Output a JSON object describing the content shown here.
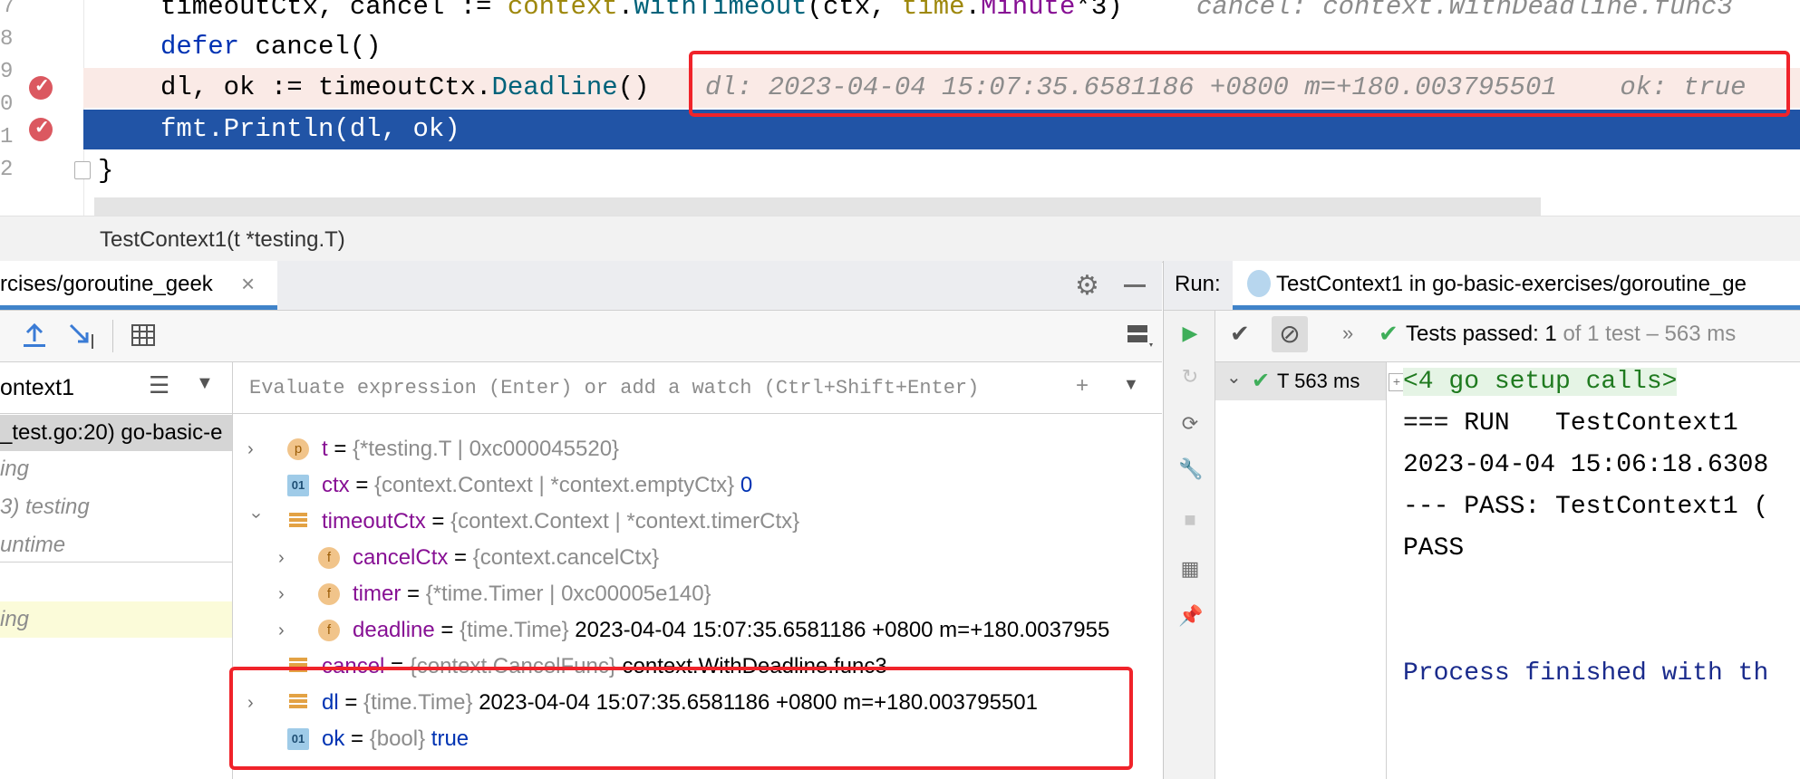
{
  "editor": {
    "line_numbers": [
      "7",
      "8",
      "9",
      "0",
      "1",
      "2"
    ],
    "lines": [
      {
        "code": "timeoutCtx, cancel := context.WithTimeout(ctx, time.Minute*3)",
        "hint": "cancel: context.WithDeadline.func3"
      },
      {
        "code": "defer cancel()"
      },
      {
        "code": "dl, ok := timeoutCtx.Deadline()",
        "hint": "dl: 2023-04-04 15:07:35.6581186 +0800 m=+180.003795501    ok: true"
      },
      {
        "code": "fmt.Println(dl, ok)"
      },
      {
        "code": "}"
      }
    ],
    "colors": {
      "execution_line": "#2154a6",
      "breakpoint_line": "#faeae6",
      "highlight_box": "#f0232a"
    }
  },
  "breadcrumb": {
    "text": "TestContext1(t *testing.T)"
  },
  "debug": {
    "tab_label": "rcises/goroutine_geek",
    "close_icon": "×",
    "evaluate_placeholder": "Evaluate expression (Enter) or add a watch (Ctrl+Shift+Enter)",
    "thread_name": "ontext1",
    "frames": [
      {
        "text": "_test.go:20) go-basic-e",
        "style": "selected"
      },
      {
        "text": "ing",
        "style": "normal"
      },
      {
        "text": "3) testing",
        "style": "normal"
      },
      {
        "text": "untime",
        "style": "normal"
      },
      {
        "text": "ing",
        "style": "library"
      }
    ],
    "variables": [
      {
        "name": "t",
        "type": "{*testing.T | 0xc000045520}",
        "value": "",
        "icon": "p",
        "expandable": true,
        "expanded": false,
        "indent": 0
      },
      {
        "name": "ctx",
        "type": "{context.Context | *context.emptyCtx}",
        "value": "0",
        "icon": "01",
        "expandable": false,
        "indent": 0,
        "value_blue": true
      },
      {
        "name": "timeoutCtx",
        "type": "{context.Context | *context.timerCtx}",
        "value": "",
        "icon": "bars",
        "expandable": true,
        "expanded": true,
        "indent": 0
      },
      {
        "name": "cancelCtx",
        "type": "{context.cancelCtx}",
        "value": "",
        "icon": "f",
        "expandable": true,
        "expanded": false,
        "indent": 1
      },
      {
        "name": "timer",
        "type": "{*time.Timer | 0xc00005e140}",
        "value": "",
        "icon": "f",
        "expandable": true,
        "expanded": false,
        "indent": 1
      },
      {
        "name": "deadline",
        "type": "{time.Time}",
        "value": "2023-04-04 15:07:35.6581186 +0800 m=+180.0037955",
        "icon": "f",
        "expandable": true,
        "expanded": false,
        "indent": 1
      },
      {
        "name": "cancel",
        "type": "{context.CancelFunc}",
        "value": "context.WithDeadline.func3",
        "icon": "bars",
        "expandable": false,
        "indent": 0
      },
      {
        "name": "dl",
        "type": "{time.Time}",
        "value": "2023-04-04 15:07:35.6581186 +0800 m=+180.003795501",
        "icon": "bars",
        "expandable": true,
        "expanded": false,
        "indent": 0,
        "name_blue": true
      },
      {
        "name": "ok",
        "type": "{bool}",
        "value": "true",
        "icon": "01",
        "expandable": false,
        "indent": 0,
        "name_blue": true,
        "value_blue": true
      }
    ]
  },
  "run": {
    "label": "Run:",
    "config_name": "TestContext1 in go-basic-exercises/goroutine_ge",
    "tests_passed_label": "Tests passed:",
    "tests_passed_count": "1",
    "tests_passed_detail": "of 1 test – 563 ms",
    "tree_item": "T",
    "tree_time": "563 ms",
    "console": [
      {
        "text": "<4 go setup calls>",
        "style": "fold"
      },
      {
        "text": "=== RUN   TestContext1",
        "style": "normal"
      },
      {
        "text": "2023-04-04 15:06:18.6308",
        "style": "normal"
      },
      {
        "text": "--- PASS: TestContext1 (",
        "style": "normal"
      },
      {
        "text": "PASS",
        "style": "normal"
      },
      {
        "text": "Process finished with th",
        "style": "process"
      }
    ]
  }
}
